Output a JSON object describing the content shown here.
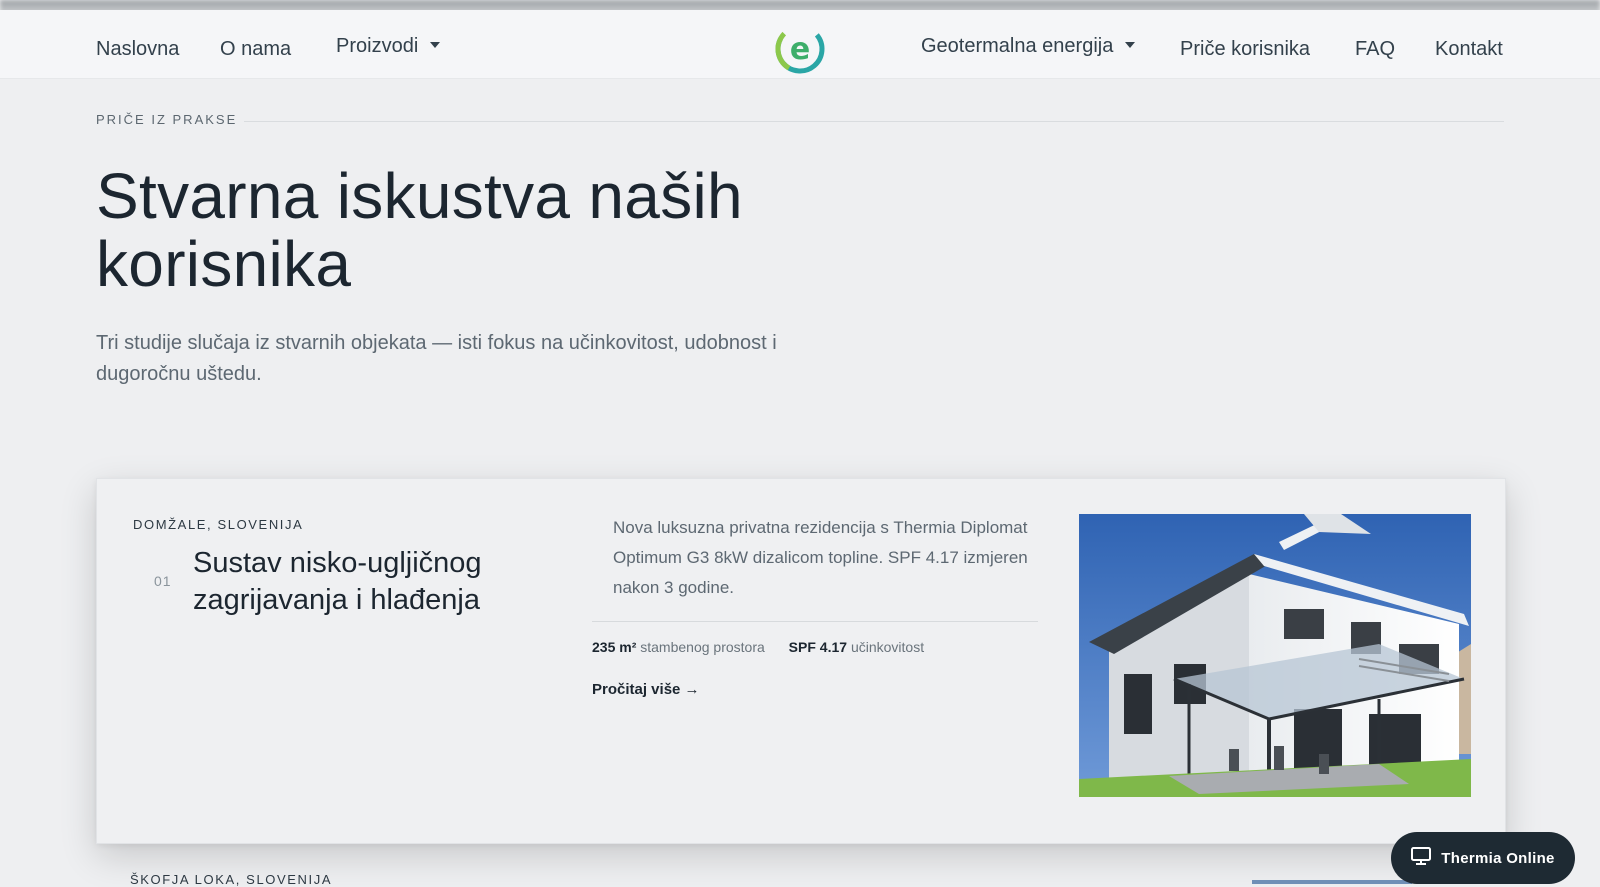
{
  "nav": {
    "left": [
      {
        "label": "Naslovna"
      },
      {
        "label": "O nama"
      },
      {
        "label": "Proizvodi",
        "dropdown": true
      }
    ],
    "right": [
      {
        "label": "Geotermalna energija",
        "dropdown": true
      },
      {
        "label": "Priče korisnika"
      },
      {
        "label": "FAQ"
      },
      {
        "label": "Kontakt"
      }
    ],
    "logo_icon": "e-logo-icon"
  },
  "hero": {
    "eyebrow": "PRIČE IZ PRAKSE",
    "title": "Stvarna iskustva naših korisnika",
    "lead": "Tri studije slučaja iz stvarnih objekata — isti fokus na učinkovitost, udobnost i dugoročnu uštedu."
  },
  "case": {
    "location": "DOMŽALE, SLOVENIJA",
    "number": "01",
    "title": "Sustav nisko-ugljičnog zagrijavanja i hlađenja",
    "description": "Nova luksuzna privatna rezidencija s Thermia Diplomat Optimum G3 8kW dizalicom topline. SPF 4.17 izmjeren nakon 3 godine.",
    "stat1_value": "235 m²",
    "stat1_label": "stambenog prostora",
    "stat2_value": "SPF 4.17",
    "stat2_label": "učinkovitost",
    "read_more": "Pročitaj više →"
  },
  "next_case_peek": "ŠKOFJA LOKA, SLOVENIJA",
  "online_button": {
    "label": "Thermia Online",
    "icon": "monitor-icon"
  },
  "colors": {
    "background": "#eeeff1",
    "text_dark": "#1c2630",
    "button_dark": "#1e2a33",
    "logo_green": "#3dae6a",
    "logo_teal": "#2aa6a6"
  }
}
